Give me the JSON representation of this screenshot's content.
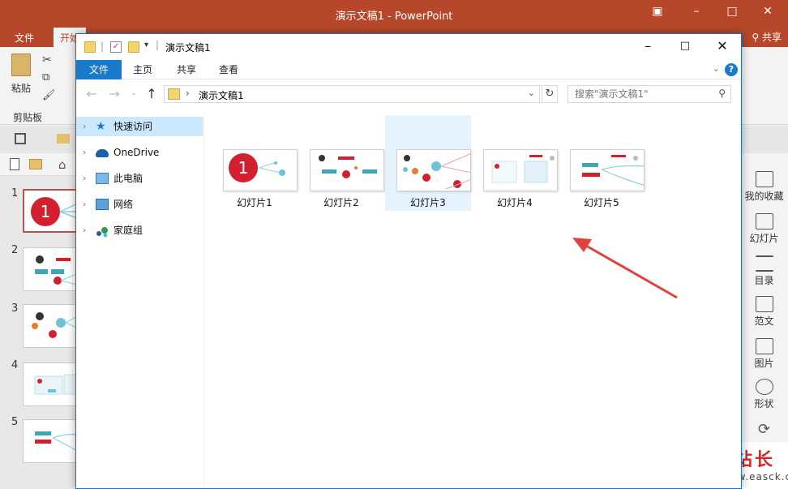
{
  "ppt": {
    "window_title": "演示文稿1 - PowerPoint",
    "tabs": [
      "文件",
      "开始"
    ],
    "share": "共享",
    "ribbon": {
      "paste": "粘贴",
      "clipboard": "剪贴板"
    },
    "slide_numbers": [
      "1",
      "2",
      "3",
      "4",
      "5"
    ],
    "right_panel": [
      "我的收藏",
      "幻灯片",
      "目录",
      "范文",
      "图片",
      "形状"
    ]
  },
  "watermark": {
    "line1": "易采站长站",
    "line2": "www.easck.com"
  },
  "explorer": {
    "title": "演示文稿1",
    "menu": [
      "文件",
      "主页",
      "共享",
      "查看"
    ],
    "help": "?",
    "address_path": "演示文稿1",
    "search_placeholder": "搜索\"演示文稿1\"",
    "nav_tree": [
      {
        "label": "快速访问",
        "icon": "star-pin-icon",
        "selected": true
      },
      {
        "label": "OneDrive",
        "icon": "cloud-icon",
        "selected": false
      },
      {
        "label": "此电脑",
        "icon": "computer-icon",
        "selected": false
      },
      {
        "label": "网络",
        "icon": "network-icon",
        "selected": false
      },
      {
        "label": "家庭组",
        "icon": "homegroup-icon",
        "selected": false
      }
    ],
    "files": [
      {
        "label": "幻灯片1",
        "selected": false
      },
      {
        "label": "幻灯片2",
        "selected": false
      },
      {
        "label": "幻灯片3",
        "selected": true
      },
      {
        "label": "幻灯片4",
        "selected": false
      },
      {
        "label": "幻灯片5",
        "selected": false
      }
    ]
  },
  "colors": {
    "ppt_red": "#b7472a",
    "explorer_blue": "#1979ca",
    "selection": "#cce8ff",
    "arrow": "#e0433a"
  }
}
